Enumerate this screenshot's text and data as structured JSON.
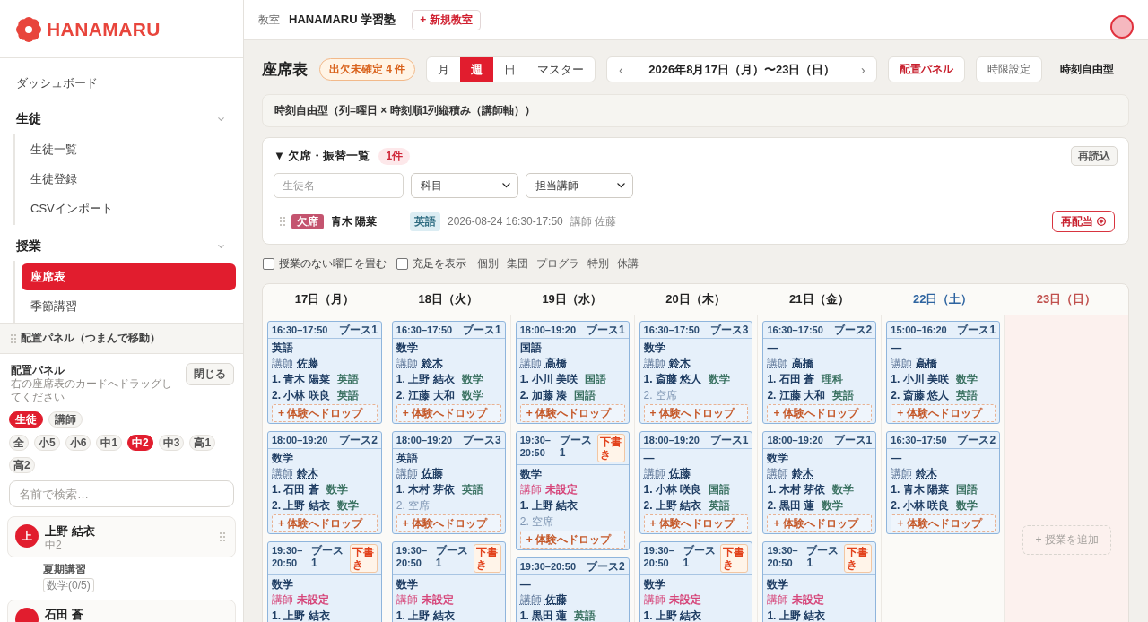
{
  "sidebar": {
    "logo": "HANAMARU",
    "nav": [
      {
        "kind": "link",
        "label": "ダッシュボード"
      },
      {
        "kind": "group",
        "label": "生徒",
        "expanded": true,
        "children": [
          {
            "label": "生徒一覧",
            "selected": false
          },
          {
            "label": "生徒登録",
            "selected": false
          },
          {
            "label": "CSVインポート",
            "selected": false
          }
        ]
      },
      {
        "kind": "group",
        "label": "授業",
        "expanded": true,
        "children": [
          {
            "label": "座席表",
            "selected": true
          },
          {
            "label": "季節講習",
            "selected": false
          }
        ]
      }
    ],
    "placement_panel": {
      "handle": "配置パネル（つまんで移動）",
      "title": "配置パネル",
      "description": "右の座席表のカードへドラッグしてください",
      "close_button": "閉じる",
      "tabs": [
        {
          "label": "生徒",
          "selected": true
        },
        {
          "label": "講師",
          "selected": false
        }
      ],
      "grades": [
        {
          "label": "全",
          "selected": false
        },
        {
          "label": "小5",
          "selected": false
        },
        {
          "label": "小6",
          "selected": false
        },
        {
          "label": "中1",
          "selected": false
        },
        {
          "label": "中2",
          "selected": true
        },
        {
          "label": "中3",
          "selected": false
        },
        {
          "label": "高1",
          "selected": false
        },
        {
          "label": "高2",
          "selected": false
        }
      ],
      "search": {
        "placeholder": "名前で検索…"
      },
      "students": [
        {
          "initial": "上",
          "name": "上野 結衣",
          "grade": "中2",
          "course": "夏期講習",
          "progress": [
            "数学(0/5)"
          ]
        },
        {
          "name": "石田 蒼"
        }
      ]
    }
  },
  "header": {
    "classroom_label": "教室",
    "classroom": "HANAMARU 学習塾",
    "new_button": "+ 新規教室"
  },
  "toolbar": {
    "title": "座席表",
    "pending_badge": "出欠未確定 4 件",
    "views": [
      {
        "label": "月",
        "selected": false
      },
      {
        "label": "週",
        "selected": true
      },
      {
        "label": "日",
        "selected": false
      },
      {
        "label": "マスター",
        "selected": false
      }
    ],
    "prev": "‹",
    "date_range": "2026年8月17日（月）〜23日（日）",
    "next": "›",
    "buttons": [
      {
        "label": "配置パネル",
        "kind": "accent"
      },
      {
        "label": "時限設定",
        "kind": "plain"
      }
    ],
    "mode": "時刻自由型"
  },
  "layout_note": "時刻自由型（列=曜日 × 時刻順1列縦積み（講師軸））",
  "absence_panel": {
    "title": "▼ 欠席・振替一覧",
    "count": "1件",
    "reload_button": "再読込",
    "student_filter": {
      "placeholder": "生徒名"
    },
    "subject_filter": {
      "value": "科目"
    },
    "teacher_filter": {
      "value": "担当講師"
    },
    "rows": [
      {
        "status": "欠席",
        "student": "青木 陽菜",
        "subject": "英語",
        "datetime": "2026-08-24 16:30-17:50",
        "teacher": "講師 佐藤",
        "action": "再配当"
      }
    ]
  },
  "options": {
    "checkboxes": [
      {
        "label": "授業のない曜日を畳む",
        "checked": false
      },
      {
        "label": "充足を表示",
        "checked": false
      }
    ],
    "legend": [
      "個別",
      "集団",
      "プログラ",
      "特別",
      "休講"
    ]
  },
  "calendar": {
    "days": [
      {
        "label": "17日（月）",
        "kind": "weekday",
        "lessons": [
          {
            "time": "16:30–17:50",
            "booth": "ブース1",
            "draft": false,
            "subject": "英語",
            "teacher_label": "講師",
            "teacher": "佐藤",
            "unassigned": false,
            "seats": [
              {
                "kind": "filled",
                "label": "1. 青木 陽菜",
                "subject": "英語"
              },
              {
                "kind": "filled",
                "label": "2. 小林 咲良",
                "subject": "英語"
              }
            ],
            "drop_zone": "+ 体験へドロップ"
          },
          {
            "time": "18:00–19:20",
            "booth": "ブース2",
            "draft": false,
            "subject": "数学",
            "teacher_label": "講師",
            "teacher": "鈴木",
            "unassigned": false,
            "seats": [
              {
                "kind": "filled",
                "label": "1. 石田 蒼",
                "subject": "数学"
              },
              {
                "kind": "filled",
                "label": "2. 上野 結衣",
                "subject": "数学"
              }
            ],
            "drop_zone": "+ 体験へドロップ"
          },
          {
            "time": "19:30–20:50",
            "booth": "ブース1",
            "draft": true,
            "draft_label": "下書き",
            "subject": "数学",
            "teacher_label": "講師",
            "teacher": "未設定",
            "unassigned": true,
            "seats": [
              {
                "kind": "filled",
                "label": "1. 上野 結衣"
              }
            ]
          }
        ]
      },
      {
        "label": "18日（火）",
        "kind": "weekday",
        "lessons": [
          {
            "time": "16:30–17:50",
            "booth": "ブース1",
            "draft": false,
            "subject": "数学",
            "teacher_label": "講師",
            "teacher": "鈴木",
            "unassigned": false,
            "seats": [
              {
                "kind": "filled",
                "label": "1. 上野 結衣",
                "subject": "数学"
              },
              {
                "kind": "filled",
                "label": "2. 江藤 大和",
                "subject": "数学"
              }
            ],
            "drop_zone": "+ 体験へドロップ"
          },
          {
            "time": "18:00–19:20",
            "booth": "ブース3",
            "draft": false,
            "subject": "英語",
            "teacher_label": "講師",
            "teacher": "佐藤",
            "unassigned": false,
            "seats": [
              {
                "kind": "filled",
                "label": "1. 木村 芽依",
                "subject": "英語"
              },
              {
                "kind": "empty",
                "label": "2. 空席"
              }
            ],
            "drop_zone": "+ 体験へドロップ"
          },
          {
            "time": "19:30–20:50",
            "booth": "ブース1",
            "draft": true,
            "draft_label": "下書き",
            "subject": "数学",
            "teacher_label": "講師",
            "teacher": "未設定",
            "unassigned": true,
            "seats": [
              {
                "kind": "filled",
                "label": "1. 上野 結衣"
              }
            ]
          }
        ]
      },
      {
        "label": "19日（水）",
        "kind": "weekday",
        "lessons": [
          {
            "time": "18:00–19:20",
            "booth": "ブース1",
            "draft": false,
            "subject": "国語",
            "teacher_label": "講師",
            "teacher": "高橋",
            "unassigned": false,
            "seats": [
              {
                "kind": "filled",
                "label": "1. 小川 美咲",
                "subject": "国語"
              },
              {
                "kind": "filled",
                "label": "2. 加藤 湊",
                "subject": "国語"
              }
            ],
            "drop_zone": "+ 体験へドロップ"
          },
          {
            "time": "19:30–20:50",
            "booth": "ブース1",
            "draft": true,
            "draft_label": "下書き",
            "subject": "数学",
            "teacher_label": "講師",
            "teacher": "未設定",
            "unassigned": true,
            "seats": [
              {
                "kind": "filled",
                "label": "1. 上野 結衣"
              },
              {
                "kind": "empty",
                "label": "2. 空席"
              }
            ],
            "drop_zone": "+ 体験へドロップ"
          },
          {
            "time": "19:30–20:50",
            "booth": "ブース2",
            "draft": false,
            "subject": "—",
            "teacher_label": "講師",
            "teacher": "佐藤",
            "unassigned": false,
            "seats": [
              {
                "kind": "filled",
                "label": "1. 黒田 蓮",
                "subject": "英語"
              }
            ]
          }
        ]
      },
      {
        "label": "20日（木）",
        "kind": "weekday",
        "lessons": [
          {
            "time": "16:30–17:50",
            "booth": "ブース3",
            "draft": false,
            "subject": "数学",
            "teacher_label": "講師",
            "teacher": "鈴木",
            "unassigned": false,
            "seats": [
              {
                "kind": "filled",
                "label": "1. 斎藤 悠人",
                "subject": "数学"
              },
              {
                "kind": "empty",
                "label": "2. 空席"
              }
            ],
            "drop_zone": "+ 体験へドロップ"
          },
          {
            "time": "18:00–19:20",
            "booth": "ブース1",
            "draft": false,
            "subject": "—",
            "teacher_label": "講師",
            "teacher": "佐藤",
            "unassigned": false,
            "seats": [
              {
                "kind": "filled",
                "label": "1. 小林 咲良",
                "subject": "国語"
              },
              {
                "kind": "filled",
                "label": "2. 上野 結衣",
                "subject": "英語"
              }
            ],
            "drop_zone": "+ 体験へドロップ"
          },
          {
            "time": "19:30–20:50",
            "booth": "ブース1",
            "draft": true,
            "draft_label": "下書き",
            "subject": "数学",
            "teacher_label": "講師",
            "teacher": "未設定",
            "unassigned": true,
            "seats": [
              {
                "kind": "filled",
                "label": "1. 上野 結衣"
              }
            ]
          }
        ]
      },
      {
        "label": "21日（金）",
        "kind": "weekday",
        "lessons": [
          {
            "time": "16:30–17:50",
            "booth": "ブース2",
            "draft": false,
            "subject": "—",
            "teacher_label": "講師",
            "teacher": "高橋",
            "unassigned": false,
            "seats": [
              {
                "kind": "filled",
                "label": "1. 石田 蒼",
                "subject": "理科"
              },
              {
                "kind": "filled",
                "label": "2. 江藤 大和",
                "subject": "英語"
              }
            ],
            "drop_zone": "+ 体験へドロップ"
          },
          {
            "time": "18:00–19:20",
            "booth": "ブース1",
            "draft": false,
            "subject": "数学",
            "teacher_label": "講師",
            "teacher": "鈴木",
            "unassigned": false,
            "seats": [
              {
                "kind": "filled",
                "label": "1. 木村 芽依",
                "subject": "数学"
              },
              {
                "kind": "filled",
                "label": "2. 黒田 蓮",
                "subject": "数学"
              }
            ],
            "drop_zone": "+ 体験へドロップ"
          },
          {
            "time": "19:30–20:50",
            "booth": "ブース1",
            "draft": true,
            "draft_label": "下書き",
            "subject": "数学",
            "teacher_label": "講師",
            "teacher": "未設定",
            "unassigned": true,
            "seats": [
              {
                "kind": "filled",
                "label": "1. 上野 結衣"
              }
            ]
          }
        ]
      },
      {
        "label": "22日（土）",
        "kind": "saturday",
        "lessons": [
          {
            "time": "15:00–16:20",
            "booth": "ブース1",
            "draft": false,
            "subject": "—",
            "teacher_label": "講師",
            "teacher": "高橋",
            "unassigned": false,
            "seats": [
              {
                "kind": "filled",
                "label": "1. 小川 美咲",
                "subject": "数学"
              },
              {
                "kind": "filled",
                "label": "2. 斎藤 悠人",
                "subject": "英語"
              }
            ],
            "drop_zone": "+ 体験へドロップ"
          },
          {
            "time": "16:30–17:50",
            "booth": "ブース2",
            "draft": false,
            "subject": "—",
            "teacher_label": "講師",
            "teacher": "鈴木",
            "unassigned": false,
            "seats": [
              {
                "kind": "filled",
                "label": "1. 青木 陽菜",
                "subject": "国語"
              },
              {
                "kind": "filled",
                "label": "2. 小林 咲良",
                "subject": "数学"
              }
            ],
            "drop_zone": "+ 体験へドロップ"
          }
        ]
      },
      {
        "label": "23日（日）",
        "kind": "sunday",
        "add_button": "+ 授業を追加"
      }
    ]
  }
}
